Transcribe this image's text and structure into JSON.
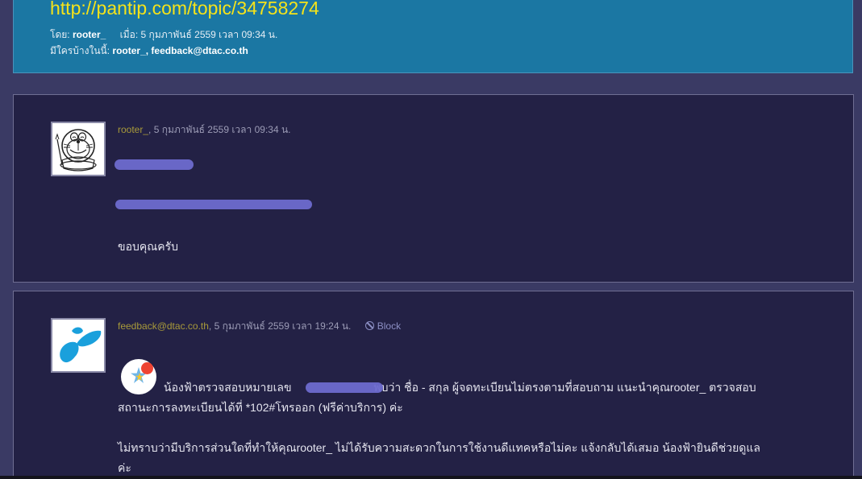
{
  "topic": {
    "url": "http://pantip.com/topic/34758274",
    "by_label": "โดย:",
    "author": "rooter_",
    "when_label": "เมื่อ:",
    "when_value": "5 กุมภาพันธ์ 2559 เวลา 09:34 น.",
    "participants_label": "มีใครบ้างในนี้:",
    "participants": "rooter_, feedback@dtac.co.th"
  },
  "comments": [
    {
      "author": "rooter_",
      "meta": ", 5 กุมภาพันธ์ 2559 เวลา 09:34 น.",
      "lines": [
        "ขอบคุณครับ"
      ]
    },
    {
      "author": "feedback@dtac.co.th",
      "meta": ", 5 กุมภาพันธ์ 2559 เวลา 19:24 น.",
      "block_label": "Block",
      "line1a": "น้องฟ้าตรวจสอบหมายเลข",
      "line1b": "พบว่า ชื่อ - สกุล ผู้จดทะเบียนไม่ตรงตามที่สอบถาม   แนะนำคุณrooter_  ตรวจสอบ",
      "line2": "สถานะการลงทะเบียนได้ที่ *102#โทรออก (ฟรีค่าบริการ) ค่ะ",
      "line3": "ไม่ทราบว่ามีบริการส่วนใดที่ทำให้คุณrooter_ ไม่ได้รับความสะดวกในการใช้งานดีแทคหรือไม่คะ  แจ้งกลับได้เสมอ น้องฟ้ายินดีช่วยดูแล",
      "line4": "ค่ะ"
    }
  ],
  "icons": {
    "comment1_avatar": "doraemon-avatar-icon",
    "comment2_avatar": "dtac-logo-icon",
    "block": "ban-icon",
    "emoji": "sparkle-badge-icon"
  },
  "colors": {
    "header_bg": "#1b77a3",
    "url": "#f5e31a",
    "comment_bg": "#232145",
    "author": "#a89a3a",
    "redaction": "#6e6bcf"
  }
}
